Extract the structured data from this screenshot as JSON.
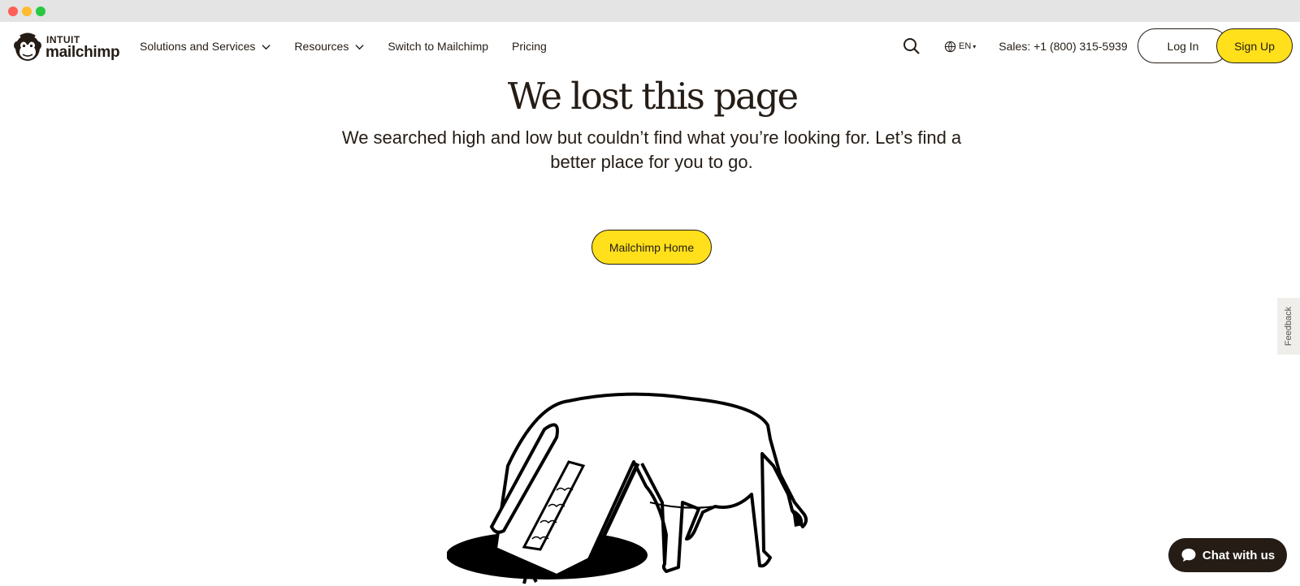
{
  "brand": {
    "top_line": "INTUIT",
    "bottom_line": "mailchimp",
    "logo_icon": "freddie-monkey-icon"
  },
  "nav": {
    "items": [
      {
        "label": "Solutions and Services",
        "has_dropdown": true
      },
      {
        "label": "Resources",
        "has_dropdown": true
      },
      {
        "label": "Switch to Mailchimp",
        "has_dropdown": false
      },
      {
        "label": "Pricing",
        "has_dropdown": false
      }
    ]
  },
  "header": {
    "search_icon": "search-icon",
    "language": "EN",
    "language_icon": "globe-icon",
    "sales": "Sales: +1 (800) 315-5939",
    "login_label": "Log In",
    "signup_label": "Sign Up"
  },
  "main": {
    "headline": "We lost this page",
    "subtext": "We searched high and low but couldn’t find what you’re looking for. Let’s find a better place for you to go.",
    "home_button": "Mailchimp Home",
    "illustration": "dog-digging-hole-illustration"
  },
  "feedback": {
    "label": "Feedback"
  },
  "chat": {
    "label": "Chat with us",
    "icon": "chat-bubble-icon"
  },
  "colors": {
    "accent_yellow": "#ffe01b",
    "ink": "#241c15",
    "background": "#ffffff"
  }
}
